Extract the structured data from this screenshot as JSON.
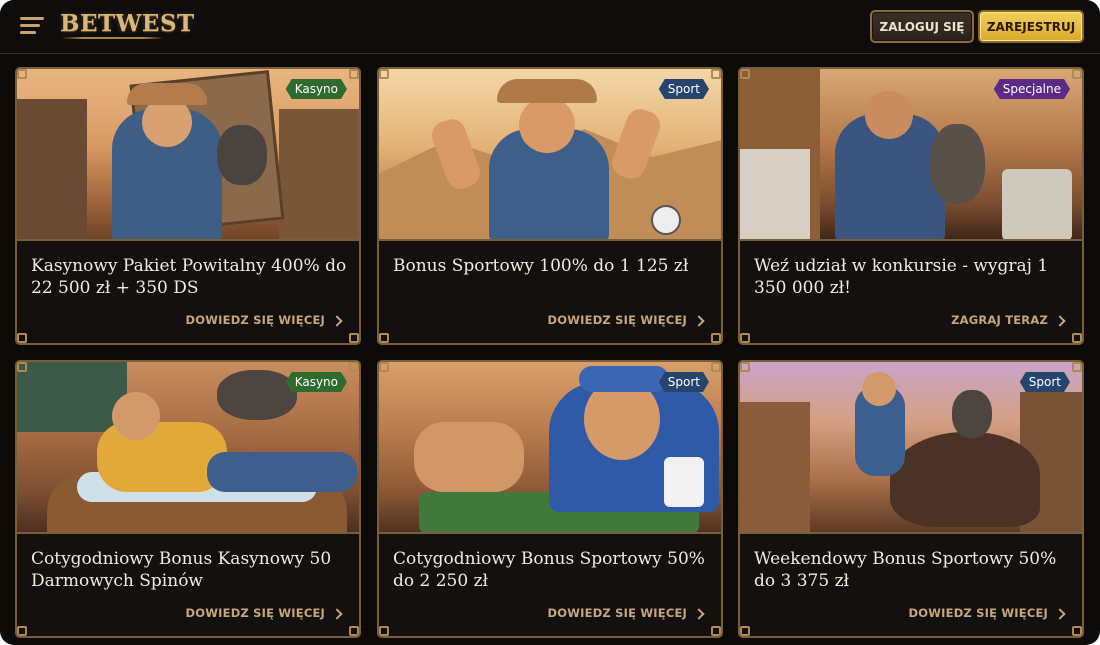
{
  "header": {
    "logo": "BETWEST",
    "login_label": "ZALOGUJ SIĘ",
    "register_label": "ZAREJESTRUJ"
  },
  "colors": {
    "background": "#0c0b0a",
    "gold": "#c9a46b",
    "badge_kasyno": "#2e6b2d",
    "badge_sport": "#26456e",
    "badge_specjalne": "#5a2a86"
  },
  "promotions": [
    {
      "badge": "Kasyno",
      "title": "Kasynowy Pakiet Powitalny 400% do 22 500 zł + 350 DS",
      "cta": "DOWIEDZ SIĘ WIĘCEJ",
      "image_icon": "cowboy-raccoon-wanted-poster-image"
    },
    {
      "badge": "Sport",
      "title": "Bonus Sportowy 100% do 1 125 zł",
      "cta": "DOWIEDZ SIĘ WIĘCEJ",
      "image_icon": "cowboy-cheering-football-image"
    },
    {
      "badge": "Specjalne",
      "title": "Weź udział w konkursie - wygraj 1 350 000 zł!",
      "cta": "ZAGRAJ TERAZ",
      "image_icon": "cowboy-raccoon-shooting-image"
    },
    {
      "badge": "Kasyno",
      "title": "Cotygodniowy Bonus Kasynowy 50 Darmowych Spinów",
      "cta": "DOWIEDZ SIĘ WIĘCEJ",
      "image_icon": "cowboy-relaxing-barrel-image"
    },
    {
      "badge": "Sport",
      "title": "Cotygodniowy Bonus Sportowy 50% do 2 250 zł",
      "cta": "DOWIEDZ SIĘ WIĘCEJ",
      "image_icon": "cowboy-cigar-rings-image"
    },
    {
      "badge": "Sport",
      "title": "Weekendowy Bonus Sportowy 50% do 3 375 zł",
      "cta": "DOWIEDZ SIĘ WIĘCEJ",
      "image_icon": "cowboy-riding-bison-image"
    }
  ]
}
